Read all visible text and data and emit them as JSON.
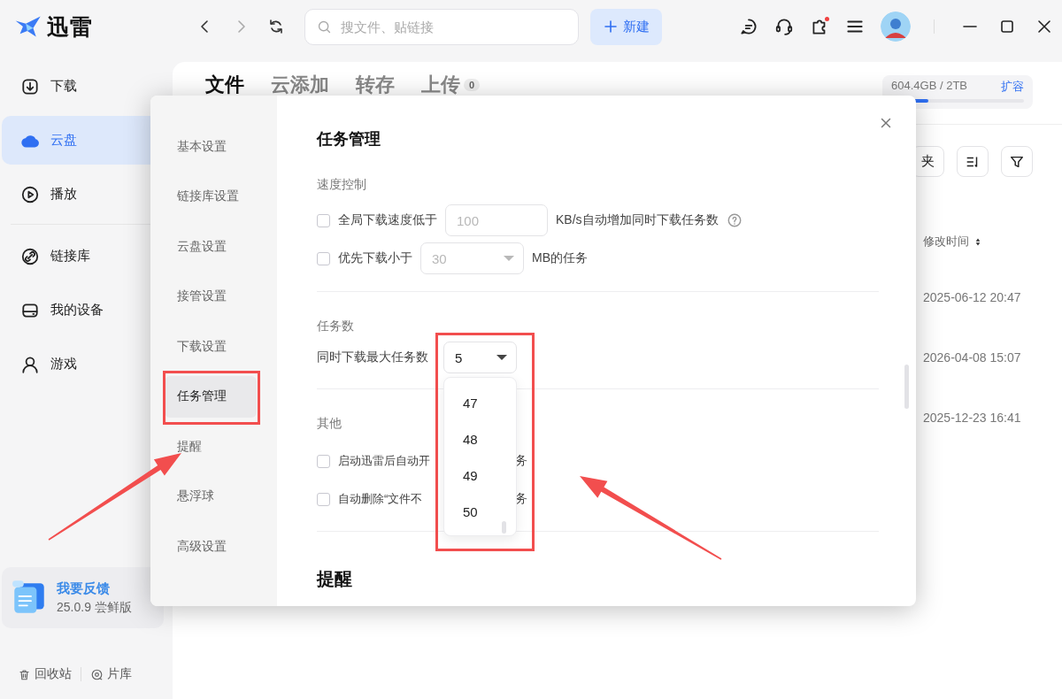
{
  "app": {
    "title": "迅雷"
  },
  "toolbar": {
    "back": {
      "disabled": false
    },
    "forward": {
      "disabled": true
    },
    "search": {
      "placeholder": "搜文件、贴链接"
    },
    "new_button": "新建",
    "plugin_notification": true
  },
  "sidebar": {
    "items": [
      {
        "label": "下载",
        "selected": false
      },
      {
        "label": "云盘",
        "selected": true
      },
      {
        "label": "播放",
        "selected": false
      },
      {
        "label": "链接库",
        "selected": false
      },
      {
        "label": "我的设备",
        "selected": false
      },
      {
        "label": "游戏",
        "selected": false
      }
    ],
    "feedback": {
      "title": "我要反馈",
      "version": "25.0.9 尝鲜版"
    },
    "bottom_links": [
      "回收站",
      "片库"
    ]
  },
  "main": {
    "tabs": [
      {
        "label": "文件",
        "selected": true
      },
      {
        "label": "云添加",
        "selected": false
      },
      {
        "label": "转存",
        "selected": false
      },
      {
        "label": "上传",
        "selected": false,
        "badge": "0"
      }
    ],
    "storage": {
      "usage": "604.4GB / 2TB",
      "action": "扩容",
      "level": 0.28
    },
    "toolbar_button": "夹",
    "table": {
      "column": "修改时间",
      "rows": [
        "2025-06-12 20:47",
        "2026-04-08 15:07",
        "2025-12-23 16:41"
      ]
    }
  },
  "dialog": {
    "nav": [
      {
        "label": "基本设置",
        "selected": false,
        "highlighted": false
      },
      {
        "label": "链接库设置",
        "selected": false,
        "highlighted": false
      },
      {
        "label": "云盘设置",
        "selected": false,
        "highlighted": false
      },
      {
        "label": "接管设置",
        "selected": false,
        "highlighted": false
      },
      {
        "label": "下载设置",
        "selected": false,
        "highlighted": false
      },
      {
        "label": "任务管理",
        "selected": true,
        "highlighted": true
      },
      {
        "label": "提醒",
        "selected": false,
        "highlighted": false
      },
      {
        "label": "悬浮球",
        "selected": false,
        "highlighted": false
      },
      {
        "label": "高级设置",
        "selected": false,
        "highlighted": false
      }
    ],
    "title": "任务管理",
    "speed": {
      "heading": "速度控制",
      "rows": [
        {
          "kind": "input",
          "checked": false,
          "label": "全局下载速度低于",
          "value": "100",
          "disabled": true,
          "suffix": "KB/s自动增加同时下载任务数",
          "help": true
        },
        {
          "kind": "select",
          "checked": false,
          "label": "优先下载小于",
          "value": "30",
          "disabled": true,
          "suffix": "MB的任务",
          "help": false
        }
      ]
    },
    "task_count": {
      "heading": "任务数",
      "label": "同时下载最大任务数",
      "select": {
        "value": "5",
        "disabled": false,
        "expanded": true,
        "highlighted": true,
        "options": [
          {
            "label": "47",
            "selected": false
          },
          {
            "label": "48",
            "selected": false
          },
          {
            "label": "49",
            "selected": false
          },
          {
            "label": "50",
            "selected": false
          }
        ]
      }
    },
    "other": {
      "heading": "其他",
      "rows": [
        {
          "checked": false,
          "label": "启动迅雷后自动开",
          "tail": "务"
        },
        {
          "checked": false,
          "label": "自动删除“文件不",
          "tail": "务"
        }
      ]
    },
    "next_heading": "提醒"
  },
  "annotation_arrows": [
    {
      "kind": "arrow"
    },
    {
      "kind": "arrow"
    }
  ]
}
